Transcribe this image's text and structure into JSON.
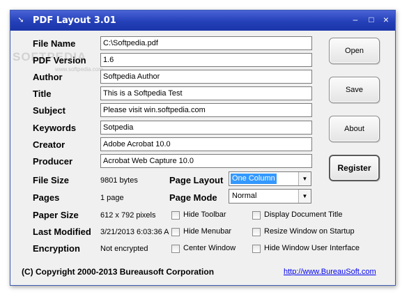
{
  "window": {
    "title": "PDF Layout 3.01",
    "minimize_glyph": "–",
    "maximize_glyph": "□",
    "close_glyph": "×",
    "app_icon": "down-arrow-icon"
  },
  "watermark": {
    "text": "SOFTPEDIA",
    "sub": "www.softpedia.com"
  },
  "fields": [
    {
      "label": "File Name",
      "value": "C:\\Softpedia.pdf"
    },
    {
      "label": "PDF Version",
      "value": "1.6"
    },
    {
      "label": "Author",
      "value": "Softpedia Author"
    },
    {
      "label": "Title",
      "value": "This is a Softpedia Test"
    },
    {
      "label": "Subject",
      "value": "Please visit win.softpedia.com"
    },
    {
      "label": "Keywords",
      "value": "Sotpedia"
    },
    {
      "label": "Creator",
      "value": "Adobe Acrobat 10.0"
    },
    {
      "label": "Producer",
      "value": "Acrobat Web Capture 10.0"
    }
  ],
  "info": [
    {
      "label": "File Size",
      "value": "9801 bytes"
    },
    {
      "label": "Pages",
      "value": "1 page"
    },
    {
      "label": "Paper Size",
      "value": "612 x 792 pixels"
    },
    {
      "label": "Last Modified",
      "value": "3/21/2013 6:03:36 A"
    },
    {
      "label": "Encryption",
      "value": "Not encrypted"
    }
  ],
  "page_layout": {
    "label": "Page Layout",
    "value": "One Column"
  },
  "page_mode": {
    "label": "Page Mode",
    "value": "Normal"
  },
  "checkboxes": [
    {
      "label": "Hide Toolbar",
      "checked": false
    },
    {
      "label": "Display Document Title",
      "checked": false
    },
    {
      "label": "Hide Menubar",
      "checked": false
    },
    {
      "label": "Resize Window on Startup",
      "checked": false
    },
    {
      "label": "Center Window",
      "checked": false
    },
    {
      "label": "Hide Window User Interface",
      "checked": false
    }
  ],
  "buttons": {
    "open": "Open",
    "save": "Save",
    "about": "About",
    "register": "Register"
  },
  "footer": {
    "copyright": "(C) Copyright 2000-2013 Bureausoft Corporation",
    "link": "http://www.BureauSoft.com"
  }
}
